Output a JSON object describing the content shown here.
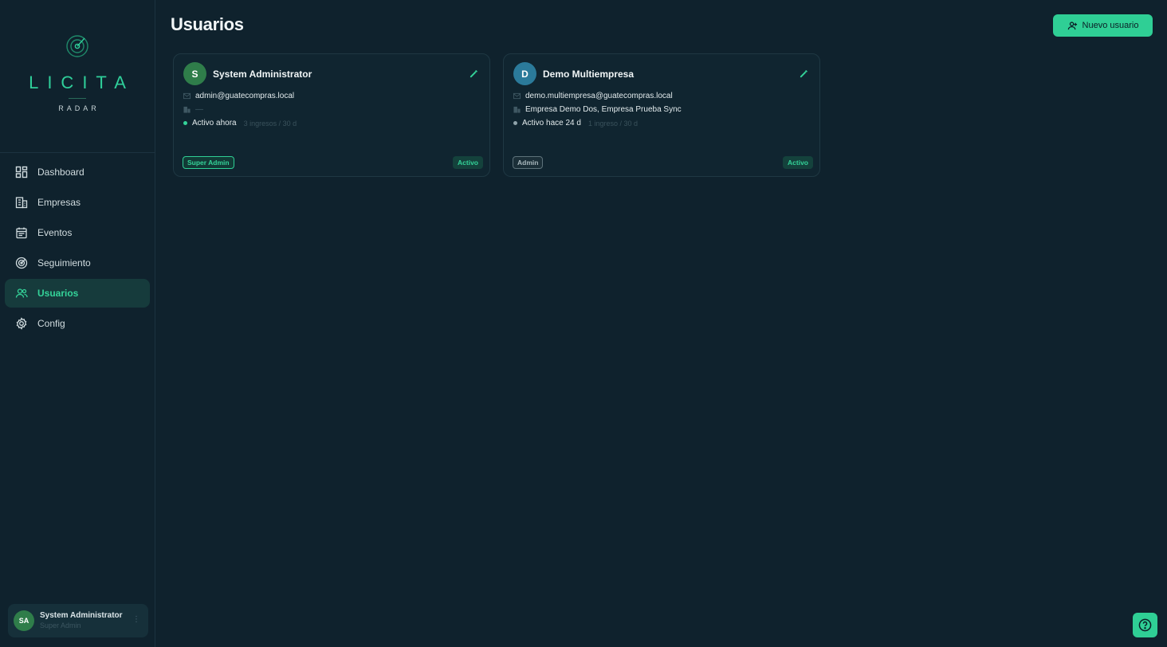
{
  "brand": {
    "word": "LICITA",
    "sub": "RADAR"
  },
  "nav": [
    {
      "label": "Dashboard",
      "icon": "dashboard-icon",
      "active": false
    },
    {
      "label": "Empresas",
      "icon": "building-icon",
      "active": false
    },
    {
      "label": "Eventos",
      "icon": "calendar-icon",
      "active": false
    },
    {
      "label": "Seguimiento",
      "icon": "radar-icon",
      "active": false
    },
    {
      "label": "Usuarios",
      "icon": "users-icon",
      "active": true
    },
    {
      "label": "Config",
      "icon": "gear-icon",
      "active": false
    }
  ],
  "current_user": {
    "initials": "SA",
    "name": "System Administrator",
    "role": "Super Admin"
  },
  "page": {
    "title": "Usuarios",
    "new_button": "Nuevo usuario"
  },
  "users": [
    {
      "initial": "S",
      "avatar_color": "#2f7d4a",
      "name": "System Administrator",
      "email": "admin@guatecompras.local",
      "companies": "—",
      "activity": "Activo ahora",
      "activity_dot": "#34d399",
      "sessions": "3 ingresos / 30 d",
      "role": "Super Admin",
      "status": "Activo"
    },
    {
      "initial": "D",
      "avatar_color": "#2b7a9a",
      "name": "Demo Multiempresa",
      "email": "demo.multiempresa@guatecompras.local",
      "companies": "Empresa Demo Dos, Empresa Prueba Sync",
      "activity": "Activo hace 24 d",
      "activity_dot": "#8fa3aa",
      "sessions": "1 ingreso / 30 d",
      "role": "Admin",
      "status": "Activo"
    }
  ],
  "colors": {
    "accent": "#2fcf95",
    "background": "#0f222d"
  }
}
